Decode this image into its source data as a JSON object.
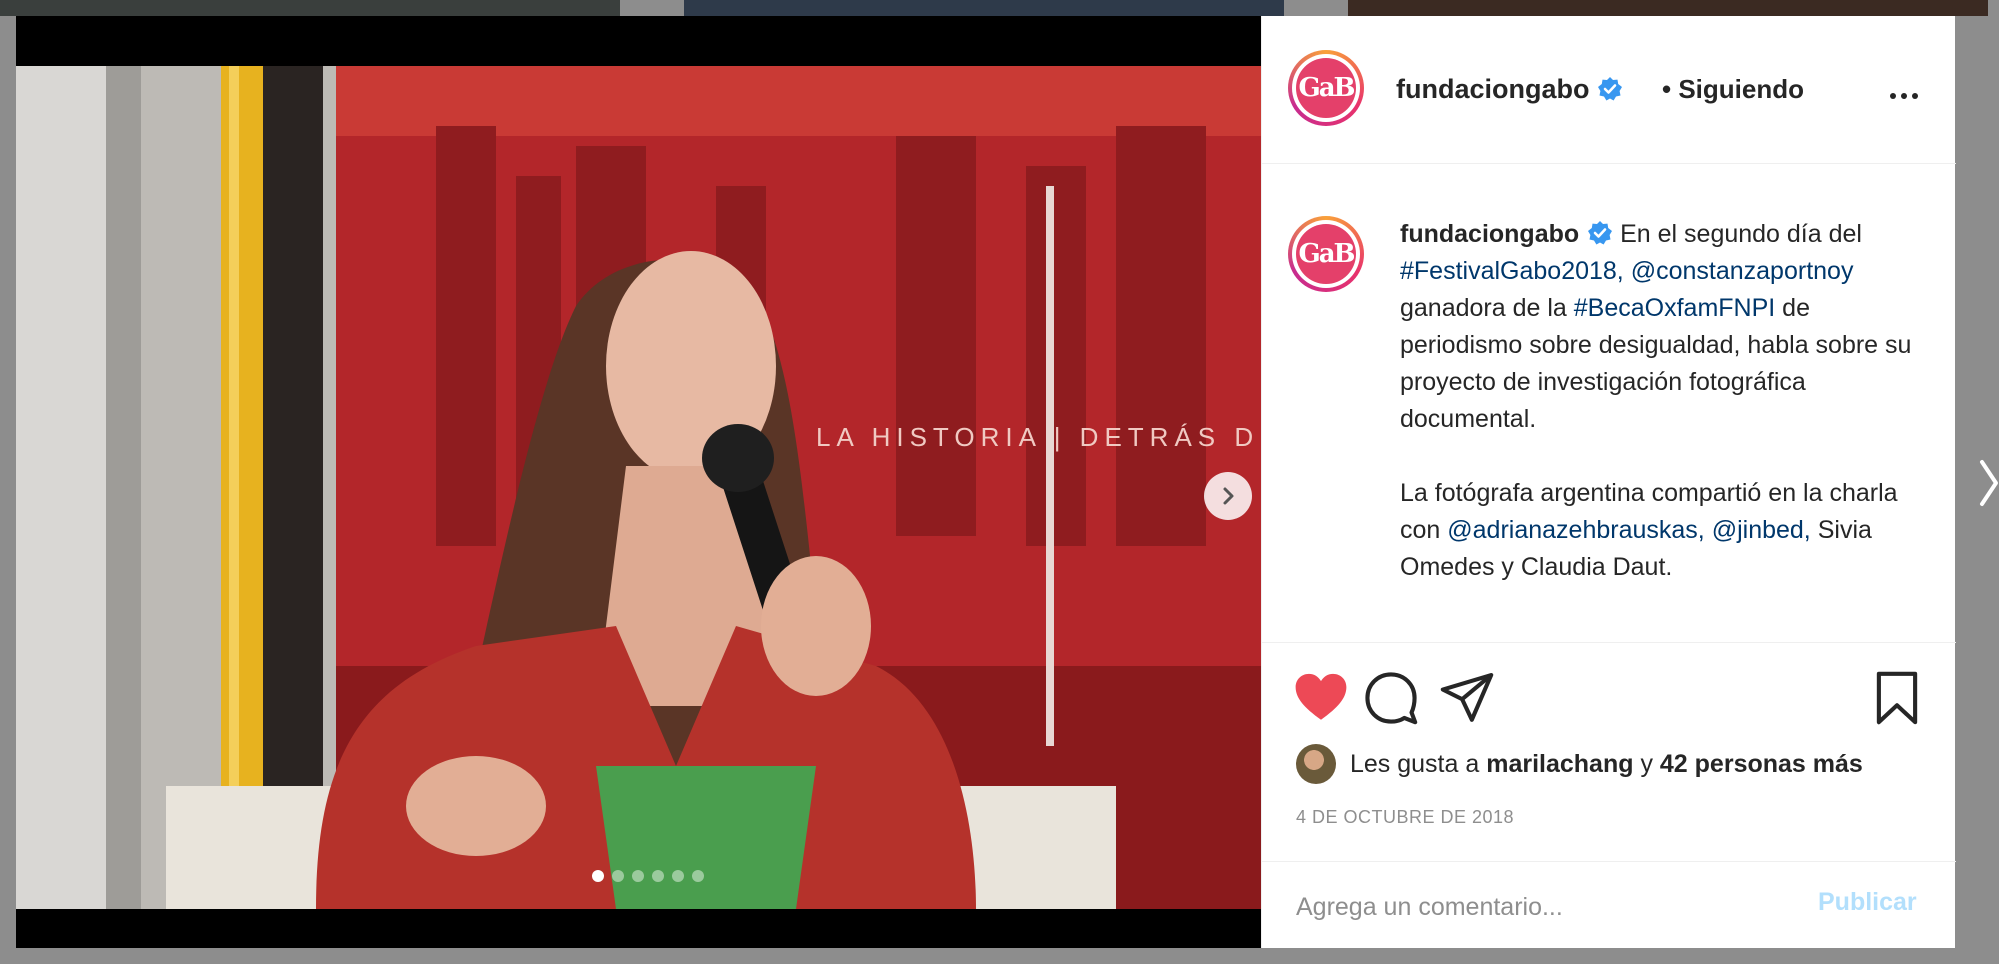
{
  "post": {
    "username": "fundaciongabo",
    "follow_status": "• Siguiendo",
    "avatar_text": "GaB"
  },
  "caption": {
    "username": "fundaciongabo",
    "t1": "En el segundo día del",
    "hashtag1": "#FestivalGabo2018,",
    "mention1": "@constanzaportnoy",
    "t2": "ganadora de la",
    "hashtag2": "#BecaOxfamFNPI",
    "t3": "de periodismo sobre desigualdad, habla sobre su proyecto de investigación fotográfica documental.",
    "t4": "La fotógrafa argentina compartió en la charla con",
    "mention2": "@adrianazehbrauskas,",
    "mention3": "@jinbed,",
    "t5": "Sivia Omedes y Claudia Daut."
  },
  "likes": {
    "prefix": "Les gusta a",
    "user": "marilachang",
    "joiner": "y",
    "others": "42 personas más"
  },
  "date": "4 DE OCTUBRE DE 2018",
  "comment": {
    "placeholder": "Agrega un comentario...",
    "post_label": "Publicar"
  },
  "carousel": {
    "total": 6,
    "active_index": 0
  },
  "colors": {
    "like_red": "#ed4956",
    "link_blue": "#00376b",
    "verified_blue": "#3897f0",
    "post_disabled": "#b2dffc"
  },
  "icons": {
    "like": "heart-filled-icon",
    "comment": "speech-bubble-icon",
    "share": "paper-plane-icon",
    "save": "bookmark-icon",
    "more": "more-options-icon",
    "next": "chevron-right-icon"
  }
}
